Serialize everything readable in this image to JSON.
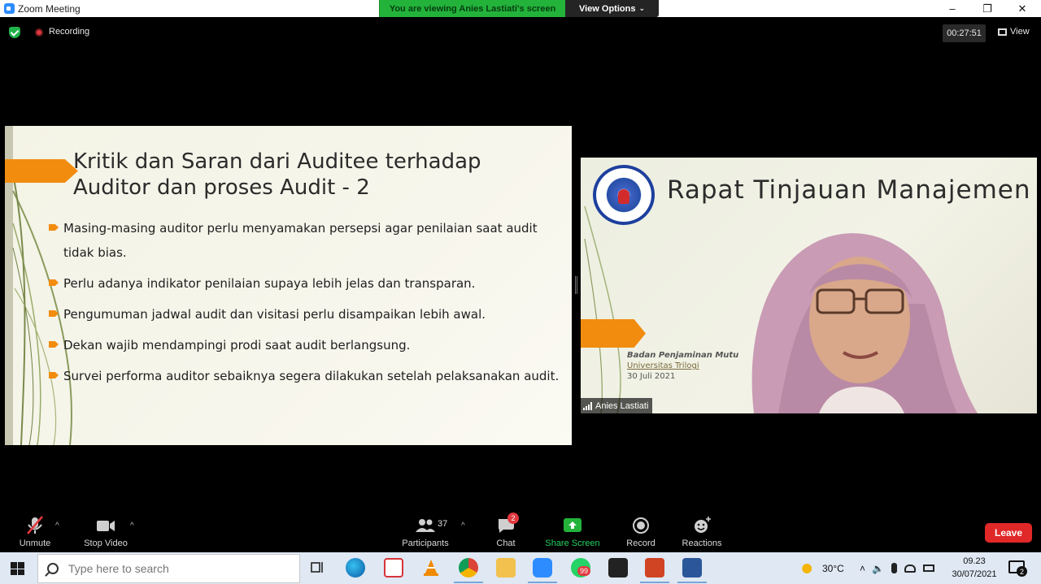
{
  "window": {
    "title": "Zoom Meeting",
    "banner_message": "You are viewing Anies Lastiati's screen",
    "banner_options": "View Options",
    "minimize": "–",
    "restore": "❐",
    "close": "✕"
  },
  "meeting_info": {
    "recording_label": "Recording",
    "timer": "00:27:51",
    "view_label": "View"
  },
  "slide": {
    "title_line1": "Kritik dan Saran dari Auditee terhadap",
    "title_line2": "Auditor dan proses Audit - 2",
    "bullets": [
      "Masing-masing auditor perlu menyamakan persepsi agar penilaian saat audit tidak bias.",
      "Perlu adanya indikator penilaian supaya lebih jelas dan transparan.",
      "Pengumuman jadwal audit dan visitasi perlu disampaikan lebih awal.",
      "Dekan wajib mendampingi prodi saat audit berlangsung.",
      "Survei performa auditor sebaiknya segera dilakukan setelah pelaksanakan audit."
    ]
  },
  "video": {
    "background_title": "Rapat Tinjauan Manajemen",
    "org_line1": "Badan Penjaminan Mutu",
    "org_line2": "Universitas Trilogi",
    "org_line3": "30 Juli 2021",
    "participant_name": "Anies Lastiati"
  },
  "toolbar": {
    "unmute": "Unmute",
    "stop_video": "Stop Video",
    "participants": "Participants",
    "participants_count": "37",
    "chat": "Chat",
    "chat_badge": "2",
    "share_screen": "Share Screen",
    "record": "Record",
    "reactions": "Reactions",
    "leave": "Leave",
    "caret": "^"
  },
  "taskbar": {
    "search_placeholder": "Type here to search",
    "whatsapp_badge": "99",
    "weather": "30°C",
    "time": "09.23",
    "date": "30/07/2021",
    "notifications_count": "2"
  },
  "colors": {
    "accent_orange": "#f28c0f",
    "banner_green": "#23b33b",
    "leave_red": "#e02828",
    "share_green": "#23d160"
  }
}
